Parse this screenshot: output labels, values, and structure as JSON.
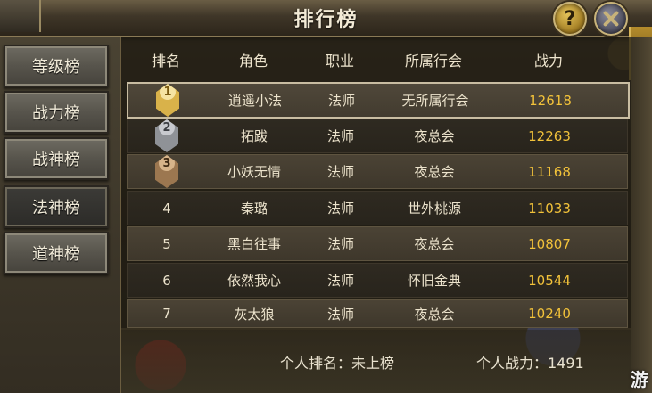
{
  "window": {
    "title": "排行榜",
    "help_label": "?",
    "close_label": "✕"
  },
  "categories": [
    {
      "label": "等级榜",
      "active": false
    },
    {
      "label": "战力榜",
      "active": false
    },
    {
      "label": "战神榜",
      "active": false
    },
    {
      "label": "法神榜",
      "active": true
    },
    {
      "label": "道神榜",
      "active": false
    }
  ],
  "table": {
    "headers": {
      "rank": "排名",
      "name": "角色",
      "job": "职业",
      "guild": "所属行会",
      "power": "战力"
    },
    "rows": [
      {
        "rank": "1",
        "name": "逍遥小法",
        "job": "法师",
        "guild": "无所属行会",
        "power": "12618"
      },
      {
        "rank": "2",
        "name": "拓跋",
        "job": "法师",
        "guild": "夜总会",
        "power": "12263"
      },
      {
        "rank": "3",
        "name": "小妖无情",
        "job": "法师",
        "guild": "夜总会",
        "power": "11168"
      },
      {
        "rank": "4",
        "name": "秦璐",
        "job": "法师",
        "guild": "世外桃源",
        "power": "11033"
      },
      {
        "rank": "5",
        "name": "黑白往事",
        "job": "法师",
        "guild": "夜总会",
        "power": "10807"
      },
      {
        "rank": "6",
        "name": "依然我心",
        "job": "法师",
        "guild": "怀旧金典",
        "power": "10544"
      },
      {
        "rank": "7",
        "name": "灰太狼",
        "job": "法师",
        "guild": "夜总会",
        "power": "10240"
      }
    ]
  },
  "footer": {
    "personal_rank": "个人排名：未上榜",
    "personal_power": "个人战力：1491"
  },
  "watermark": "游",
  "colors": {
    "power": "#f2c23a",
    "medal_gold": "#d9b24a",
    "medal_silver": "#8f9297",
    "medal_bronze": "#9c7750"
  }
}
